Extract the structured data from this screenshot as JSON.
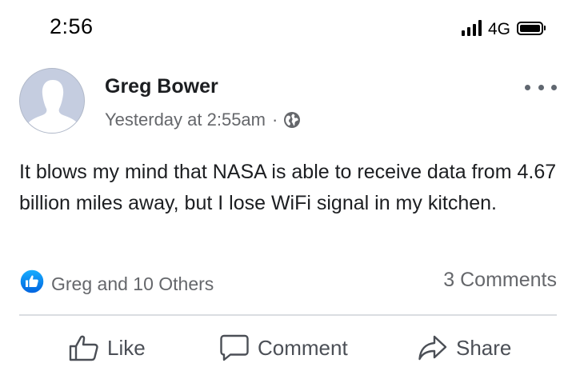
{
  "status_bar": {
    "time": "2:56",
    "network": "4G",
    "signal_icon": "cellular-signal-icon",
    "battery_icon": "battery-icon"
  },
  "post": {
    "author": "Greg Bower",
    "timestamp": "Yesterday at 2:55am",
    "separator": "·",
    "privacy_icon": "globe-icon",
    "avatar_icon": "default-profile-silhouette",
    "more_icon": "more-options-icon",
    "text": "It blows my mind that NASA is able to receive data from 4.67 billion miles away, but I lose WiFi signal in my kitchen.",
    "reactions": {
      "icon": "like-reaction-icon",
      "summary": "Greg and 10 Others"
    },
    "comments_count": "3 Comments"
  },
  "actions": {
    "like_label": "Like",
    "comment_label": "Comment",
    "share_label": "Share"
  },
  "colors": {
    "text_primary": "#1c1e21",
    "text_secondary": "#65676b",
    "like_blue": "#1877f2",
    "divider": "#dadde1"
  }
}
